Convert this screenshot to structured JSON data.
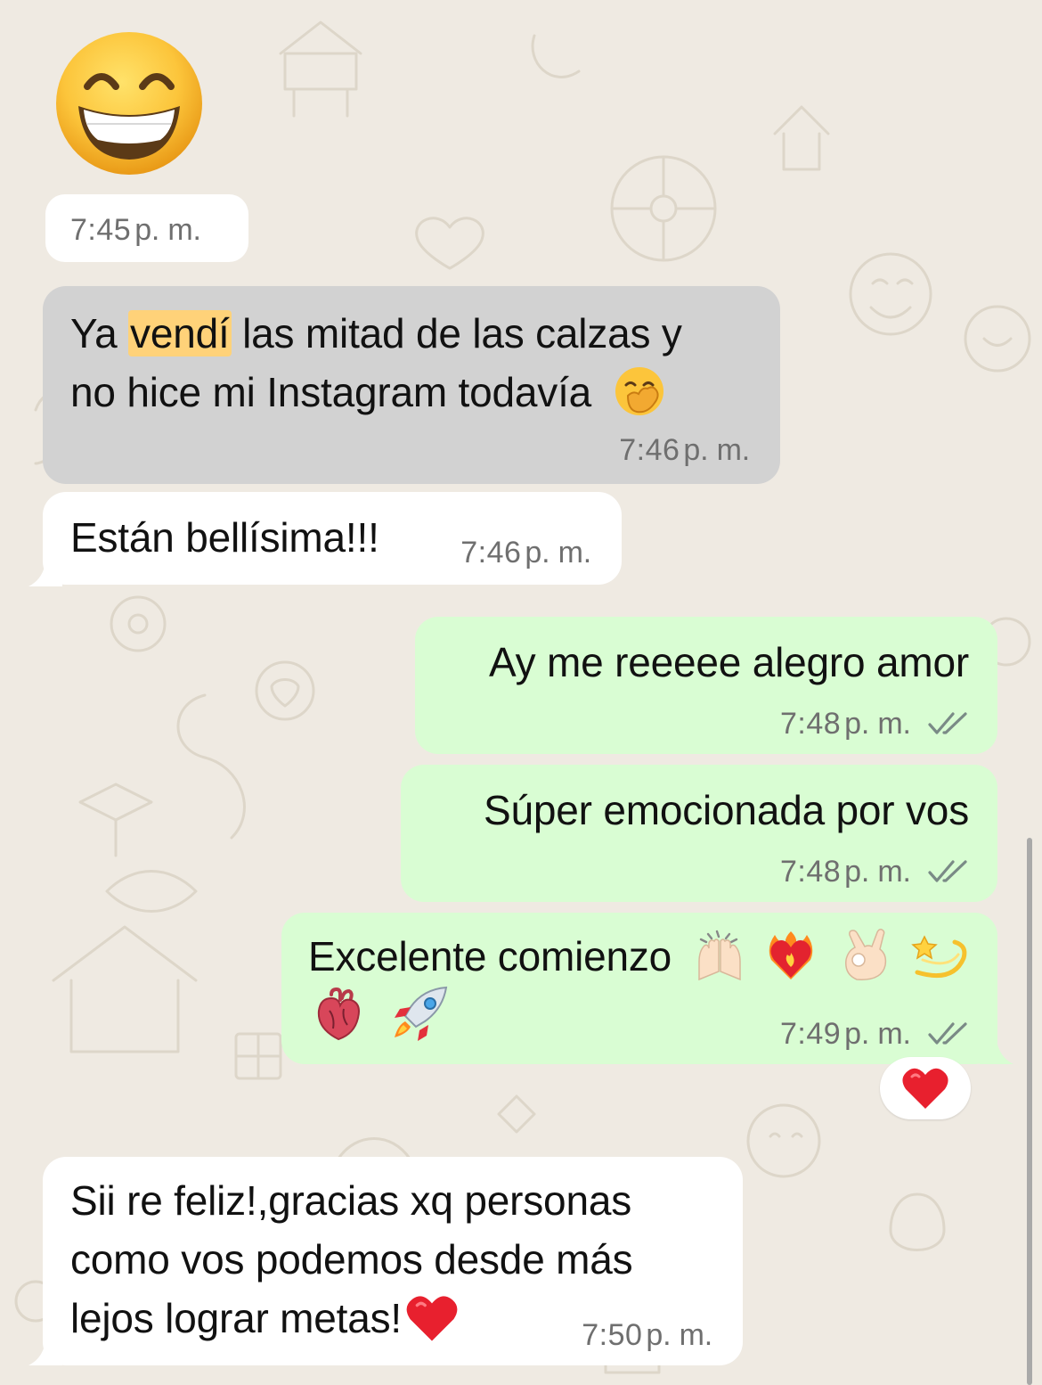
{
  "colors": {
    "background": "#efeae2",
    "incoming_bubble": "#ffffff",
    "selected_bubble": "#d2d2d2",
    "outgoing_bubble": "#d9fdd3",
    "highlight": "#ffd279",
    "meta_text": "#6f6f6f",
    "ticks": "#7a8a86"
  },
  "large_emoji": {
    "icon": "grinning-face-with-smiling-eyes-icon"
  },
  "messages": [
    {
      "direction": "incoming",
      "time": "7:45",
      "time_suffix": "p. m."
    },
    {
      "direction": "incoming",
      "selected": true,
      "text_before": "Ya ",
      "highlighted_word": "vendí",
      "text_after": " las mitad de las calzas y",
      "line2": "no hice mi Instagram todavía",
      "emoji_icon": "face-with-hand-over-mouth-icon",
      "time": "7:46",
      "time_suffix": "p. m."
    },
    {
      "direction": "incoming",
      "text": "Están bellísima!!!",
      "time": "7:46",
      "time_suffix": "p. m."
    },
    {
      "direction": "outgoing",
      "text": "Ay me reeeee alegro amor",
      "time": "7:48",
      "time_suffix": "p. m.",
      "status_icon": "double-check-icon"
    },
    {
      "direction": "outgoing",
      "text": "Súper emocionada por vos",
      "time": "7:48",
      "time_suffix": "p. m.",
      "status_icon": "double-check-icon"
    },
    {
      "direction": "outgoing",
      "text": "Excelente comienzo",
      "emoji_icons_line1": [
        "raising-hands-icon",
        "heart-on-fire-icon",
        "ok-hand-icon",
        "dizzy-icon"
      ],
      "emoji_icons_line2": [
        "anatomical-heart-icon",
        "rocket-icon"
      ],
      "time": "7:49",
      "time_suffix": "p. m.",
      "status_icon": "double-check-icon",
      "reaction_icon": "red-heart-icon"
    },
    {
      "direction": "incoming",
      "line1": "Sii re feliz!,gracias xq personas",
      "line2": "como vos podemos desde más",
      "line3": "lejos lograr metas!",
      "emoji_icon": "red-heart-icon",
      "time": "7:50",
      "time_suffix": "p. m."
    }
  ]
}
